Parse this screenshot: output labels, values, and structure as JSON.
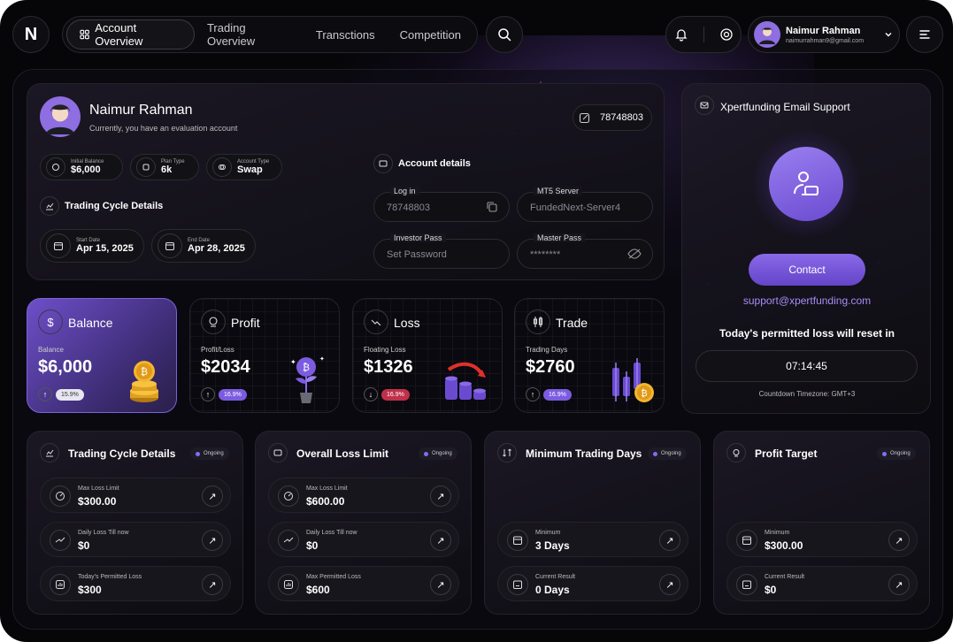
{
  "header": {
    "logo_letter": "N",
    "nav": [
      {
        "label": "Account Overview",
        "icon": "grid-icon",
        "active": true
      },
      {
        "label": "Trading Overview"
      },
      {
        "label": "Transctions"
      },
      {
        "label": "Competition"
      }
    ],
    "user": {
      "name": "Naimur Rahman",
      "email": "naimurrahman9@gmail.com"
    }
  },
  "profile": {
    "name": "Naimur Rahman",
    "subtitle": "Currently, you have an evaluation account",
    "account_id": "78748803",
    "chips": [
      {
        "label": "Initial Balance",
        "value": "$6,000"
      },
      {
        "label": "Plan Type",
        "value": "6k"
      },
      {
        "label": "Account Type",
        "value": "Swap"
      }
    ],
    "cycle_title": "Trading Cycle Details",
    "start": {
      "label": "Start Date",
      "value": "Apr 15, 2025"
    },
    "end": {
      "label": "End Date",
      "value": "Apr 28, 2025"
    },
    "account_details_title": "Account details",
    "fields": {
      "login": {
        "label": "Log in",
        "value": "78748803"
      },
      "server": {
        "label": "MT5 Server",
        "value": "FundedNext-Server4"
      },
      "investor": {
        "label": "Investor Pass",
        "placeholder": "Set Password"
      },
      "master": {
        "label": "Master Pass",
        "value": "********"
      }
    }
  },
  "support": {
    "title": "Xpertfunding Email Support",
    "contact_label": "Contact",
    "email": "support@xpertfunding.com",
    "reset_text": "Today's permitted loss will reset in",
    "countdown": "07:14:45",
    "timezone": "Countdown Timezone: GMT+3"
  },
  "stats": [
    {
      "title": "Balance",
      "label": "Balance",
      "value": "$6,000",
      "pct": "15.9%",
      "direction": "up"
    },
    {
      "title": "Profit",
      "label": "Profit/Loss",
      "value": "$2034",
      "pct": "16.9%",
      "direction": "up"
    },
    {
      "title": "Loss",
      "label": "Floating Loss",
      "value": "$1326",
      "pct": "16.9%",
      "direction": "down"
    },
    {
      "title": "Trade",
      "label": "Trading Days",
      "value": "$2760",
      "pct": "16.9%",
      "direction": "up"
    }
  ],
  "bottom": {
    "status": "Ongoing",
    "cards": [
      {
        "title": "Trading Cycle Details",
        "rows": [
          {
            "label": "Max Loss Limit",
            "value": "$300.00"
          },
          {
            "label": "Daily Loss Till now",
            "value": "$0"
          },
          {
            "label": "Today's Permitted Loss",
            "value": "$300"
          }
        ]
      },
      {
        "title": "Overall Loss Limit",
        "rows": [
          {
            "label": "Max Loss Limit",
            "value": "$600.00"
          },
          {
            "label": "Daily Loss Till now",
            "value": "$0"
          },
          {
            "label": "Max Permitted Loss",
            "value": "$600"
          }
        ]
      },
      {
        "title": "Minimum Trading Days",
        "rows": [
          {
            "label": "Minimum",
            "value": "3 Days"
          },
          {
            "label": "Current Result",
            "value": "0 Days"
          }
        ]
      },
      {
        "title": "Profit Target",
        "rows": [
          {
            "label": "Minimum",
            "value": "$300.00"
          },
          {
            "label": "Current Result",
            "value": "$0"
          }
        ]
      }
    ]
  },
  "colors": {
    "accent": "#7b5ce0",
    "accent_light": "#9a7ff0",
    "link": "#a98cf5"
  }
}
